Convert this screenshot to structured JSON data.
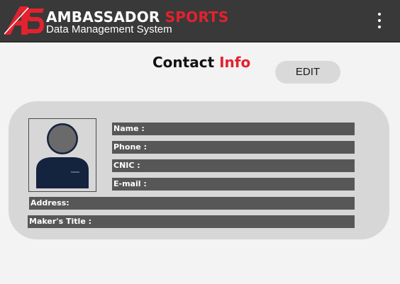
{
  "appbar": {
    "logo_text": "AS",
    "brand_primary": "AMBASSADOR",
    "brand_accent": "SPORTS",
    "subtitle": "Data Management System",
    "menu_icon": "kebab-menu-icon"
  },
  "page": {
    "heading_primary": "Contact",
    "heading_accent": "Info",
    "edit_label": "EDIT"
  },
  "contact": {
    "avatar_icon": "person-avatar-icon",
    "name_label": "Name  :",
    "phone_label": "Phone :",
    "cnic_label": "CNIC :",
    "email_label": "E-mail :",
    "address_label": "Address:",
    "makers_title_label": "Maker's Title :"
  },
  "colors": {
    "accent": "#e2222f",
    "appbar": "#393939",
    "card": "#d7d7d7",
    "field": "#575757",
    "avatar_dark": "#14233e"
  }
}
